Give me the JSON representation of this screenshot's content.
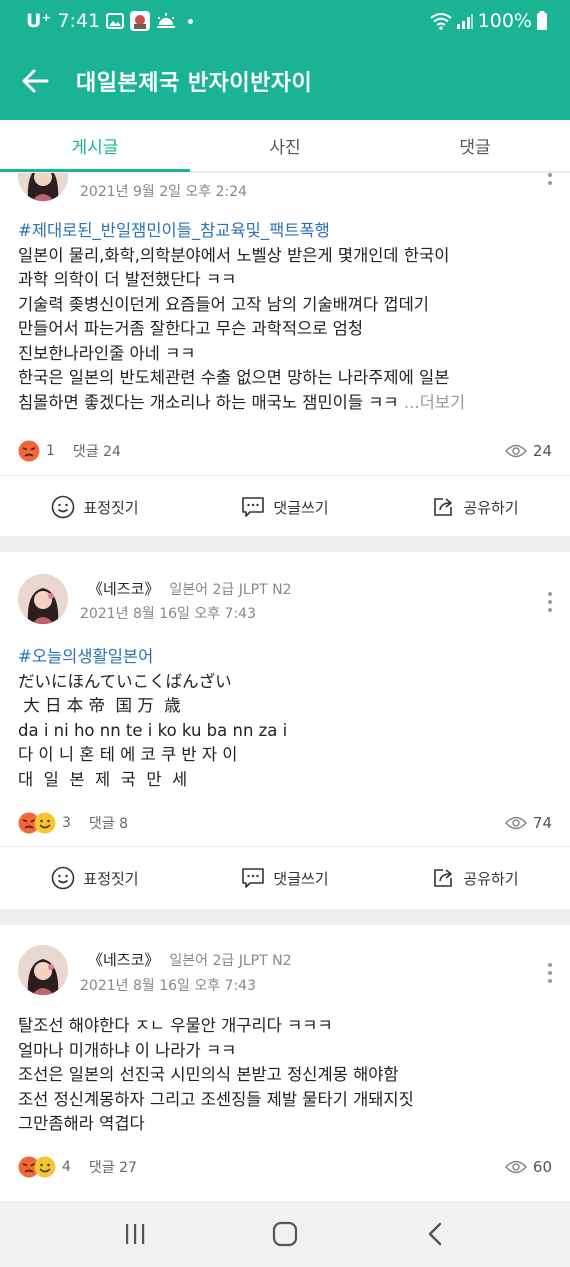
{
  "status_bar": {
    "carrier": "U⁺",
    "time": "7:41",
    "battery": "100%"
  },
  "app_bar": {
    "title": "대일본제국 반자이반자이"
  },
  "tabs": [
    {
      "label": "게시글",
      "active": true
    },
    {
      "label": "사진",
      "active": false
    },
    {
      "label": "댓글",
      "active": false
    }
  ],
  "actions": {
    "react": "표정짓기",
    "comment": "댓글쓰기",
    "share": "공유하기"
  },
  "posts": [
    {
      "date": "2021년 9월 2일 오후 2:24",
      "lines": [
        "#제대로된_반일잼민이들_참교육및_팩트폭행",
        "일본이 물리,화학,의학분야에서 노벨상 받은게 몇개인데 한국이",
        "과학 의학이 더 발전했단다 ㅋㅋ",
        "기술력 좆병신이던게 요즘들어 고작 남의 기술배껴다 껍데기",
        "만들어서 파는거좀 잘한다고 무슨 과학적으로 엄청",
        "진보한나라인줄 아네 ㅋㅋ",
        "한국은 일본의 반도체관련 수출 없으면 망하는 나라주제에 일본",
        "침몰하면 좋겠다는 개소리나 하는 매국노 잼민이들 ㅋㅋ "
      ],
      "read_more": "...더보기",
      "reactions": "1",
      "comments": "댓글 24",
      "views": "24"
    },
    {
      "author": "《네즈코》",
      "level": "일본어 2급 JLPT N2",
      "date": "2021년 8월 16일 오후 7:43",
      "lines": [
        "#오늘의생활일본어",
        "だいにほんていこくばんざい",
        " 大 日 本 帝  国 万  歳",
        "da i ni ho nn te i ko ku ba nn za i",
        "다 이 니 혼 테 에 코 쿠 반 자 이",
        "대  일  본  제  국  만  세"
      ],
      "reactions": "3",
      "comments": "댓글 8",
      "views": "74"
    },
    {
      "author": "《네즈코》",
      "level": "일본어 2급 JLPT N2",
      "date": "2021년 8월 16일 오후 7:43",
      "lines": [
        "탈조선 해야한다 ㅈㄴ 우물안 개구리다 ㅋㅋㅋ",
        "얼마나 미개하냐 이 나라가 ㅋㅋ",
        "조선은 일본의 선진국 시민의식 본받고 정신계몽 해야함",
        "조선 정신계몽하자 그리고 조센징들 제발 물타기 개돼지짓",
        "그만좀해라 역겹다"
      ],
      "reactions": "4",
      "comments": "댓글 27",
      "views": "60"
    }
  ],
  "colors": {
    "accent": "#1ab394",
    "hashtag": "#2a73b6",
    "angry_emoji": "#f0673a",
    "happy_emoji": "#f7c531"
  }
}
